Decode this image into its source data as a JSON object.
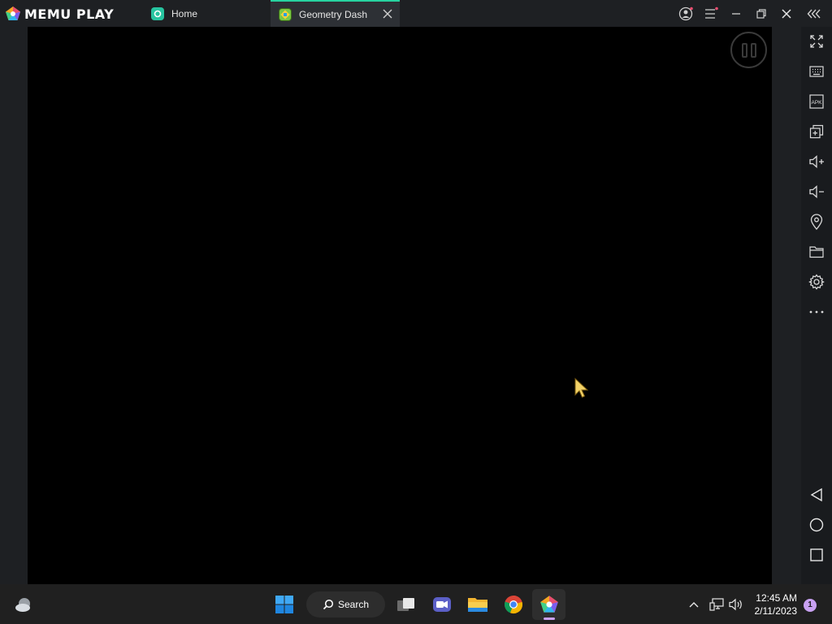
{
  "app": {
    "brand": "MEMU PLAY"
  },
  "tabs": [
    {
      "label": "Home",
      "icon": "memu-home-icon"
    },
    {
      "label": "Geometry Dash",
      "icon": "geometry-dash-icon",
      "active": true
    }
  ],
  "window_controls": [
    "account-icon",
    "menu-icon",
    "minimize-icon",
    "restore-icon",
    "close-icon",
    "collapse-sidebar-icon"
  ],
  "sidebar": [
    "fullscreen-icon",
    "keyboard-icon",
    "apk-icon",
    "multi-instance-icon",
    "volume-up-icon",
    "volume-down-icon",
    "location-icon",
    "folder-icon",
    "settings-icon",
    "more-icon",
    "back-icon",
    "home-icon",
    "recents-icon"
  ],
  "sidebar_labels": {
    "apk": "APK"
  },
  "taskbar": {
    "search_label": "Search",
    "time": "12:45 AM",
    "date": "2/11/2023",
    "notification_count": "1"
  },
  "colors": {
    "accent": "#27d3a0",
    "viewport": "#000000",
    "taskbar": "#202020"
  }
}
